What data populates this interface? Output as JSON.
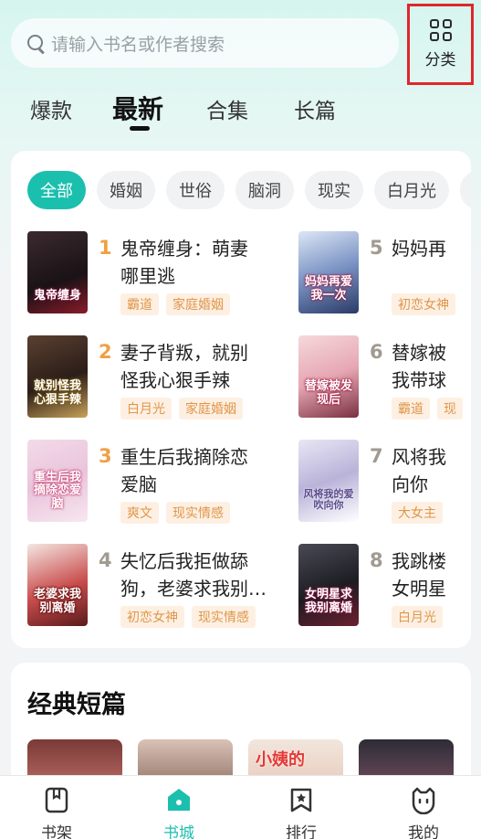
{
  "search": {
    "placeholder": "请输入书名或作者搜索"
  },
  "category_button": {
    "label": "分类",
    "icon": "grid-icon"
  },
  "tabs": [
    {
      "label": "爆款",
      "active": false
    },
    {
      "label": "最新",
      "active": true
    },
    {
      "label": "合集",
      "active": false
    },
    {
      "label": "长篇",
      "active": false
    }
  ],
  "chips": [
    {
      "label": "全部",
      "active": true
    },
    {
      "label": "婚姻"
    },
    {
      "label": "世俗"
    },
    {
      "label": "脑洞"
    },
    {
      "label": "现实"
    },
    {
      "label": "白月光"
    }
  ],
  "books": [
    {
      "rank": "1",
      "title": "鬼帝缠身：萌妻哪里逃",
      "tags": [
        "霸道",
        "家庭婚姻"
      ],
      "cover_text": "鬼帝缠身"
    },
    {
      "rank": "2",
      "title": "妻子背叛，就别怪我心狠手辣",
      "tags": [
        "白月光",
        "家庭婚姻"
      ],
      "cover_text": "就别怪我心狠手辣"
    },
    {
      "rank": "3",
      "title": "重生后我摘除恋爱脑",
      "tags": [
        "爽文",
        "现实情感"
      ],
      "cover_text": "重生后我摘除恋爱脑"
    },
    {
      "rank": "4",
      "title": "失忆后我拒做舔狗，老婆求我别…",
      "tags": [
        "初恋女神",
        "现实情感"
      ],
      "cover_text": "老婆求我别离婚"
    },
    {
      "rank": "5",
      "title": "妈妈再爱我一次",
      "tags": [
        "初恋女神"
      ],
      "cover_text": "妈妈再爱我一次"
    },
    {
      "rank": "6",
      "title": "替嫁被发现后我带球跑",
      "tags": [
        "霸道",
        "现"
      ],
      "cover_text": "替嫁被发现后"
    },
    {
      "rank": "7",
      "title": "风将我的爱吹向你",
      "tags": [
        "大女主"
      ],
      "cover_text": "风将我的爱吹向你"
    },
    {
      "rank": "8",
      "title": "我跳楼后女明星求我别离婚",
      "tags": [
        "白月光"
      ],
      "cover_text": "女明星求我别离婚"
    }
  ],
  "visible_titles": {
    "b5": "妈妈再",
    "b6": "替嫁被\n我带球",
    "b7": "风将我\n向你",
    "b8": "我跳楼\n女明星",
    "b1": "鬼帝缠身：萌妻\n哪里逃",
    "b2": "妻子背叛，就别\n怪我心狠手辣",
    "b3": "重生后我摘除恋\n爱脑",
    "b4": "失忆后我拒做舔\n狗，老婆求我别…"
  },
  "classic": {
    "title": "经典短篇",
    "thumb3_text": "小姨的"
  },
  "bottom_nav": [
    {
      "label": "书架",
      "icon": "bookshelf-icon"
    },
    {
      "label": "书城",
      "icon": "bookstore-icon",
      "active": true
    },
    {
      "label": "排行",
      "icon": "ranking-icon"
    },
    {
      "label": "我的",
      "icon": "profile-icon"
    }
  ],
  "colors": {
    "accent": "#1bbfae",
    "rank_gold": "#f0a044",
    "tag_bg": "#fdf0e3",
    "tag_text": "#e0964a",
    "highlight_border": "#e0262b"
  }
}
